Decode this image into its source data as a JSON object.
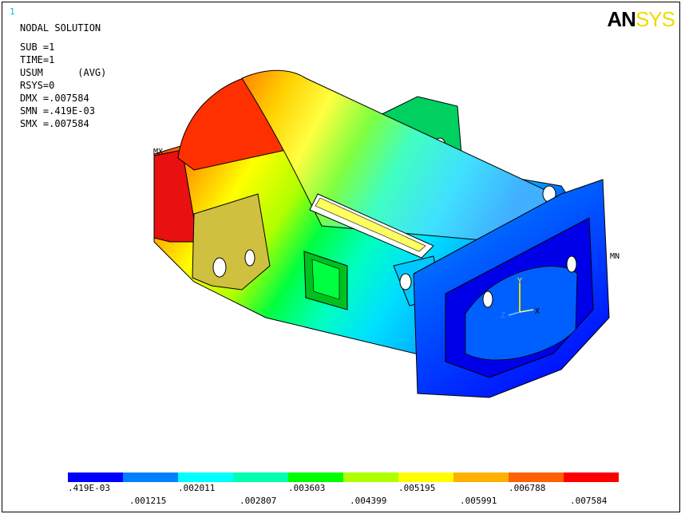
{
  "window_number": "1",
  "logo": {
    "left": "AN",
    "right": "SYS"
  },
  "info": {
    "title": "NODAL SOLUTION",
    "sub": "SUB =1",
    "time": "TIME=1",
    "usum": "USUM      (AVG)",
    "rsys": "RSYS=0",
    "dmx": "DMX =.007584",
    "smn": "SMN =.419E-03",
    "smx": "SMX =.007584"
  },
  "markers": {
    "max": "MX",
    "min": "MN",
    "axis_y": "Y",
    "axis_x": "X",
    "axis_z": "Z"
  },
  "legend": {
    "colors": [
      "#0000ff",
      "#0080ff",
      "#00ffff",
      "#00ffb0",
      "#00ff00",
      "#b0ff00",
      "#ffff00",
      "#ffb000",
      "#ff6000",
      "#ff0000"
    ],
    "labels_top": [
      ".419E-03",
      ".002011",
      ".003603",
      ".005195",
      ".006788"
    ],
    "labels_bottom": [
      ".001215",
      ".002807",
      ".004399",
      ".005991",
      ".007584"
    ]
  }
}
